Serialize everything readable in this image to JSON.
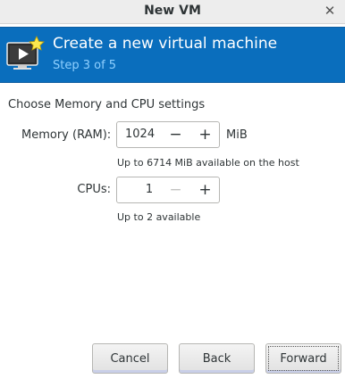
{
  "window": {
    "title": "New VM",
    "close_glyph": "✕"
  },
  "banner": {
    "icon": "vm-monitor-icon",
    "heading": "Create a new virtual machine",
    "step": "Step 3 of 5",
    "bg_color": "#0a6ebd",
    "step_color": "#8fd0ff"
  },
  "settings": {
    "section_title": "Choose Memory and CPU settings",
    "memory": {
      "label": "Memory (RAM):",
      "value": "1024",
      "unit": "MiB",
      "hint": "Up to 6714 MiB available on the host",
      "minus": "−",
      "plus": "+"
    },
    "cpus": {
      "label": "CPUs:",
      "value": "1",
      "hint": "Up to 2 available",
      "minus": "−",
      "plus": "+"
    }
  },
  "footer": {
    "cancel": "Cancel",
    "back": "Back",
    "forward": "Forward"
  }
}
